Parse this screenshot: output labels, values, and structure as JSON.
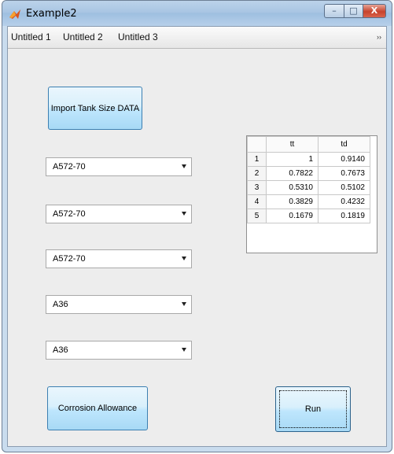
{
  "window": {
    "title": "Example2",
    "controls": {
      "minimize": "–",
      "maximize": "□",
      "close": "X"
    }
  },
  "toolbar": {
    "items": [
      "Untitled 1",
      "Untitled 2",
      "Untitled 3"
    ],
    "overflow_icon": "chevron-right-icon"
  },
  "buttons": {
    "import": "Import Tank Size DATA",
    "corrosion": "Corrosion Allowance",
    "run": "Run"
  },
  "dropdowns": [
    {
      "value": "A572-70"
    },
    {
      "value": "A572-70"
    },
    {
      "value": "A572-70"
    },
    {
      "value": "A36"
    },
    {
      "value": "A36"
    }
  ],
  "table": {
    "columns": [
      "tt",
      "td"
    ],
    "rows": [
      {
        "index": "1",
        "tt": "1",
        "td": "0.9140"
      },
      {
        "index": "2",
        "tt": "0.7822",
        "td": "0.7673"
      },
      {
        "index": "3",
        "tt": "0.5310",
        "td": "0.5102"
      },
      {
        "index": "4",
        "tt": "0.3829",
        "td": "0.4232"
      },
      {
        "index": "5",
        "tt": "0.1679",
        "td": "0.1819"
      }
    ]
  }
}
